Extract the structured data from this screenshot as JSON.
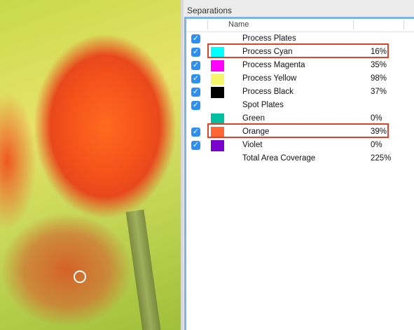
{
  "panel": {
    "title": "Separations",
    "column_name": "Name"
  },
  "rows": [
    {
      "checked": true,
      "label": "Process Plates",
      "pct": "",
      "color": ""
    },
    {
      "checked": true,
      "label": "Process Cyan",
      "pct": "16%",
      "color": "#00ffff"
    },
    {
      "checked": true,
      "label": "Process Magenta",
      "pct": "35%",
      "color": "#ff00ff"
    },
    {
      "checked": true,
      "label": "Process Yellow",
      "pct": "98%",
      "color": "#f7f56a"
    },
    {
      "checked": true,
      "label": "Process Black",
      "pct": "37%",
      "color": "#000000"
    },
    {
      "checked": true,
      "label": "Spot Plates",
      "pct": "",
      "color": ""
    },
    {
      "checked": false,
      "label": "Green",
      "pct": "0%",
      "color": "#00bfa0"
    },
    {
      "checked": true,
      "label": "Orange",
      "pct": "39%",
      "color": "#ff6633"
    },
    {
      "checked": true,
      "label": "Violet",
      "pct": "0%",
      "color": "#7a00cc"
    },
    {
      "checked": false,
      "label": "Total Area Coverage",
      "pct": "225%",
      "color": ""
    }
  ],
  "colors": {
    "highlight": "#d8452a",
    "checkbox": "#2f8ff0",
    "focus_ring": "#7fb3e6"
  }
}
